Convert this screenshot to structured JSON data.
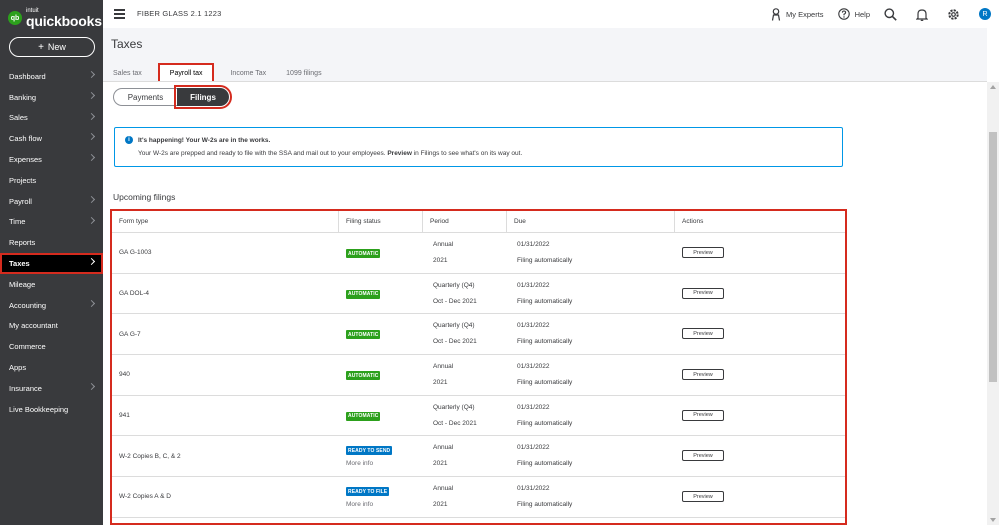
{
  "sidebar": {
    "logo": {
      "intuit": "intuit",
      "name": "quickbooks",
      "mark": "qb"
    },
    "new_button": {
      "plus": "+",
      "label": "New"
    },
    "items": [
      {
        "label": "Dashboard",
        "chevron": true
      },
      {
        "label": "Banking",
        "chevron": true
      },
      {
        "label": "Sales",
        "chevron": true
      },
      {
        "label": "Cash flow",
        "chevron": true
      },
      {
        "label": "Expenses",
        "chevron": true
      },
      {
        "label": "Projects",
        "chevron": false
      },
      {
        "label": "Payroll",
        "chevron": true
      },
      {
        "label": "Time",
        "chevron": true
      },
      {
        "label": "Reports",
        "chevron": false
      },
      {
        "label": "Taxes",
        "chevron": true,
        "active": true
      },
      {
        "label": "Mileage",
        "chevron": false
      },
      {
        "label": "Accounting",
        "chevron": true
      },
      {
        "label": "My accountant",
        "chevron": false
      },
      {
        "label": "Commerce",
        "chevron": false
      },
      {
        "label": "Apps",
        "chevron": false
      },
      {
        "label": "Insurance",
        "chevron": true
      },
      {
        "label": "Live Bookkeeping",
        "chevron": false
      }
    ]
  },
  "topbar": {
    "company": "FIBER GLASS 2.1 1223",
    "my_experts": "My Experts",
    "help": "Help",
    "avatar_initial": "R",
    "icons": [
      "menu-icon",
      "person-icon",
      "help-icon",
      "search-icon",
      "bell-icon",
      "gear-icon"
    ]
  },
  "page": {
    "title": "Taxes",
    "tabs": [
      {
        "label": "Sales tax"
      },
      {
        "label": "Payroll tax",
        "selected": true
      },
      {
        "label": "Income Tax"
      },
      {
        "label": "1099 filings"
      }
    ],
    "segments": {
      "payments": "Payments",
      "filings": "Filings"
    },
    "alert": {
      "icon": "i",
      "title": "It's happening! Your W-2s are in the works.",
      "body_pre": "Your W-2s are prepped and ready to file with the SSA and mail out to your employees.",
      "body_bold": "Preview",
      "body_post": "in Filings to see what's on its way out."
    },
    "section_title": "Upcoming filings"
  },
  "table": {
    "columns": [
      "Form type",
      "Filing status",
      "Period",
      "Due",
      "Actions"
    ],
    "rows": [
      {
        "form": "GA G-1003",
        "status": "AUTOMATIC",
        "status_type": "auto",
        "more": "",
        "period1": "Annual",
        "period2": "2021",
        "due1": "01/31/2022",
        "due2": "Filing automatically",
        "action": "Preview"
      },
      {
        "form": "GA DOL-4",
        "status": "AUTOMATIC",
        "status_type": "auto",
        "more": "",
        "period1": "Quarterly (Q4)",
        "period2": "Oct - Dec 2021",
        "due1": "01/31/2022",
        "due2": "Filing automatically",
        "action": "Preview"
      },
      {
        "form": "GA G-7",
        "status": "AUTOMATIC",
        "status_type": "auto",
        "more": "",
        "period1": "Quarterly (Q4)",
        "period2": "Oct - Dec 2021",
        "due1": "01/31/2022",
        "due2": "Filing automatically",
        "action": "Preview"
      },
      {
        "form": "940",
        "status": "AUTOMATIC",
        "status_type": "auto",
        "more": "",
        "period1": "Annual",
        "period2": "2021",
        "due1": "01/31/2022",
        "due2": "Filing automatically",
        "action": "Preview"
      },
      {
        "form": "941",
        "status": "AUTOMATIC",
        "status_type": "auto",
        "more": "",
        "period1": "Quarterly (Q4)",
        "period2": "Oct - Dec 2021",
        "due1": "01/31/2022",
        "due2": "Filing automatically",
        "action": "Preview"
      },
      {
        "form": "W-2 Copies B, C, & 2",
        "status": "READY TO SEND",
        "status_type": "send",
        "more": "More info",
        "period1": "Annual",
        "period2": "2021",
        "due1": "01/31/2022",
        "due2": "Filing automatically",
        "action": "Preview"
      },
      {
        "form": "W-2 Copies A & D",
        "status": "READY TO FILE",
        "status_type": "file",
        "more": "More info",
        "period1": "Annual",
        "period2": "2021",
        "due1": "01/31/2022",
        "due2": "Filing automatically",
        "action": "Preview"
      }
    ]
  },
  "colors": {
    "sidebar_bg": "#393a3d",
    "brand_green": "#2ca01c",
    "accent_blue": "#0077c5",
    "highlight_red": "#d52b1e"
  }
}
